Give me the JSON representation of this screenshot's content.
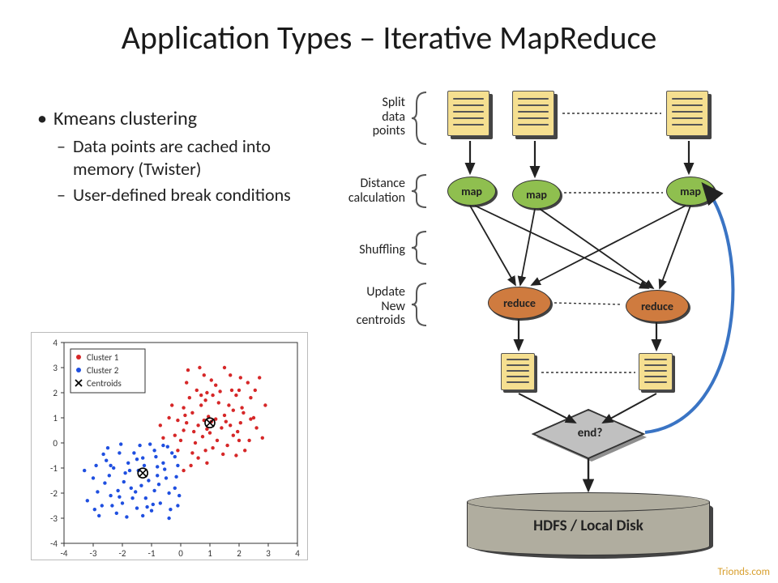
{
  "title": "Application Types – Iterative MapReduce",
  "bullets": {
    "b1": "Kmeans clustering",
    "b2": "Data points are cached into memory (Twister)",
    "b3": "User-defined break conditions"
  },
  "side_labels": {
    "split": "Split\ndata\npoints",
    "dist": "Distance\ncalculation",
    "shuf": "Shuffling",
    "upd": "Update\nNew\ncentroids"
  },
  "nodes": {
    "map": "map",
    "reduce": "reduce",
    "end": "end?",
    "hdfs": "HDFS / Local Disk"
  },
  "legend": {
    "c1": "Cluster 1",
    "c2": "Cluster 2",
    "cen": "Centroids"
  },
  "watermark": "Trionds.com",
  "chart_data": {
    "type": "scatter",
    "title": "",
    "xlabel": "",
    "ylabel": "",
    "xlim": [
      -4,
      4
    ],
    "ylim": [
      -4,
      4
    ],
    "xticks": [
      -4,
      -3,
      -2,
      -1,
      0,
      1,
      2,
      3,
      4
    ],
    "yticks": [
      -4,
      -3,
      -2,
      -1,
      0,
      1,
      2,
      3,
      4
    ],
    "series": [
      {
        "name": "Cluster 1",
        "color": "#d62728",
        "marker": ".",
        "points": [
          [
            0.1,
            0.5
          ],
          [
            0.4,
            1.2
          ],
          [
            0.8,
            0.9
          ],
          [
            -0.3,
            1.5
          ],
          [
            0.9,
            2.0
          ],
          [
            1.5,
            1.1
          ],
          [
            1.8,
            0.3
          ],
          [
            0.2,
            2.4
          ],
          [
            2.0,
            2.1
          ],
          [
            2.5,
            1.0
          ],
          [
            1.1,
            -0.2
          ],
          [
            0.6,
            -0.6
          ],
          [
            1.7,
            2.7
          ],
          [
            2.8,
            0.2
          ],
          [
            0.0,
            0.1
          ],
          [
            0.5,
            0.0
          ],
          [
            -0.1,
            0.9
          ],
          [
            0.3,
            1.8
          ],
          [
            1.3,
            1.6
          ],
          [
            1.9,
            1.9
          ],
          [
            2.3,
            2.4
          ],
          [
            2.6,
            0.6
          ],
          [
            0.9,
            -0.8
          ],
          [
            1.4,
            0.6
          ],
          [
            0.7,
            1.5
          ],
          [
            1.0,
            0.4
          ],
          [
            1.6,
            -0.1
          ],
          [
            2.1,
            1.4
          ],
          [
            2.4,
            1.8
          ],
          [
            0.4,
            -0.4
          ],
          [
            -0.2,
            0.3
          ],
          [
            -0.4,
            1.0
          ],
          [
            -0.6,
            0.2
          ],
          [
            0.8,
            2.7
          ],
          [
            1.2,
            2.3
          ],
          [
            2.9,
            1.5
          ],
          [
            2.2,
            -0.3
          ],
          [
            0.1,
            -1.1
          ],
          [
            -0.7,
            0.7
          ],
          [
            1.5,
            3.0
          ],
          [
            2.7,
            2.6
          ],
          [
            0.6,
            0.7
          ],
          [
            1.8,
            1.3
          ],
          [
            0.95,
            1.05
          ],
          [
            0.2,
            0.8
          ],
          [
            0.85,
            -0.3
          ],
          [
            1.25,
            0.1
          ],
          [
            2.05,
            0.8
          ],
          [
            1.1,
            1.9
          ],
          [
            0.55,
            2.1
          ],
          [
            1.95,
            0.45
          ],
          [
            0.35,
            -0.9
          ],
          [
            1.55,
            0.85
          ],
          [
            2.35,
            0.1
          ],
          [
            0.15,
            1.1
          ],
          [
            0.75,
            0.25
          ],
          [
            1.7,
            0.7
          ],
          [
            0.45,
            0.45
          ],
          [
            2.05,
            2.6
          ],
          [
            1.35,
            2.05
          ],
          [
            1.65,
            1.5
          ],
          [
            1.05,
            0.85
          ],
          [
            0.25,
            2.9
          ],
          [
            0.65,
            3.0
          ],
          [
            2.55,
            2.1
          ],
          [
            2.15,
            1.2
          ],
          [
            1.45,
            -0.45
          ],
          [
            0.9,
            0.55
          ],
          [
            0.1,
            1.4
          ],
          [
            0.7,
            1.9
          ],
          [
            1.9,
            -0.5
          ],
          [
            -0.1,
            -0.3
          ],
          [
            1.2,
            0.95
          ],
          [
            2.4,
            0.95
          ],
          [
            0.85,
            1.7
          ],
          [
            1.05,
            2.5
          ],
          [
            1.75,
            2.1
          ],
          [
            2.0,
            0.1
          ]
        ]
      },
      {
        "name": "Cluster 2",
        "color": "#1f4fe0",
        "marker": ".",
        "points": [
          [
            -2.8,
            -2.9
          ],
          [
            -2.4,
            -2.1
          ],
          [
            -1.9,
            -1.2
          ],
          [
            -1.3,
            -0.6
          ],
          [
            -0.8,
            -1.3
          ],
          [
            -0.4,
            -2.0
          ],
          [
            -2.1,
            -0.4
          ],
          [
            -1.5,
            -2.6
          ],
          [
            -0.9,
            -0.3
          ],
          [
            -2.6,
            -1.6
          ],
          [
            -3.2,
            -2.3
          ],
          [
            -0.2,
            -1.8
          ],
          [
            -1.7,
            -1.8
          ],
          [
            -1.0,
            -2.7
          ],
          [
            -0.6,
            -0.8
          ],
          [
            -2.0,
            -2.4
          ],
          [
            -2.9,
            -0.9
          ],
          [
            -1.2,
            -2.2
          ],
          [
            -0.1,
            -0.9
          ],
          [
            -2.3,
            -1.0
          ],
          [
            -3.0,
            -1.4
          ],
          [
            -0.5,
            -1.4
          ],
          [
            -1.4,
            -0.1
          ],
          [
            -1.8,
            -0.8
          ],
          [
            -0.7,
            -2.4
          ],
          [
            -2.5,
            -0.2
          ],
          [
            -1.1,
            -1.5
          ],
          [
            -1.6,
            -0.4
          ],
          [
            -0.3,
            -0.4
          ],
          [
            -2.2,
            -2.8
          ],
          [
            -0.9,
            -1.9
          ],
          [
            -1.3,
            -2.9
          ],
          [
            -2.7,
            -2.5
          ],
          [
            -0.1,
            -2.5
          ],
          [
            -0.4,
            -3.0
          ],
          [
            -1.95,
            -1.55
          ],
          [
            -1.45,
            -1.1
          ],
          [
            -2.15,
            -1.9
          ],
          [
            -2.55,
            -0.7
          ],
          [
            -0.85,
            -0.55
          ],
          [
            -0.15,
            -1.35
          ],
          [
            -1.25,
            -0.9
          ],
          [
            -1.65,
            -2.2
          ],
          [
            -0.55,
            -1.05
          ],
          [
            -2.05,
            -0.05
          ],
          [
            -2.85,
            -1.95
          ],
          [
            -1.05,
            -0.05
          ],
          [
            -0.45,
            -0.15
          ],
          [
            -0.2,
            -0.55
          ],
          [
            -0.75,
            -1.65
          ],
          [
            -2.35,
            -2.5
          ],
          [
            -1.55,
            -1.95
          ],
          [
            -2.45,
            -1.3
          ],
          [
            -1.85,
            -2.95
          ],
          [
            -0.95,
            -2.45
          ],
          [
            -0.05,
            -2.1
          ],
          [
            -3.3,
            -1.1
          ],
          [
            -1.35,
            -1.7
          ],
          [
            -0.35,
            -2.65
          ],
          [
            -2.65,
            -0.45
          ],
          [
            -2.95,
            -2.65
          ],
          [
            -0.6,
            -0.1
          ],
          [
            -1.75,
            -1.1
          ],
          [
            -1.15,
            -2.55
          ],
          [
            -0.8,
            -0.95
          ],
          [
            -2.1,
            -2.15
          ],
          [
            -1.5,
            -0.65
          ],
          [
            -2.4,
            -0.9
          ]
        ]
      },
      {
        "name": "Centroids",
        "color": "#000000",
        "marker": "x",
        "points": [
          [
            1.0,
            0.8
          ],
          [
            -1.3,
            -1.2
          ]
        ]
      }
    ],
    "legend_position": "upper left"
  }
}
